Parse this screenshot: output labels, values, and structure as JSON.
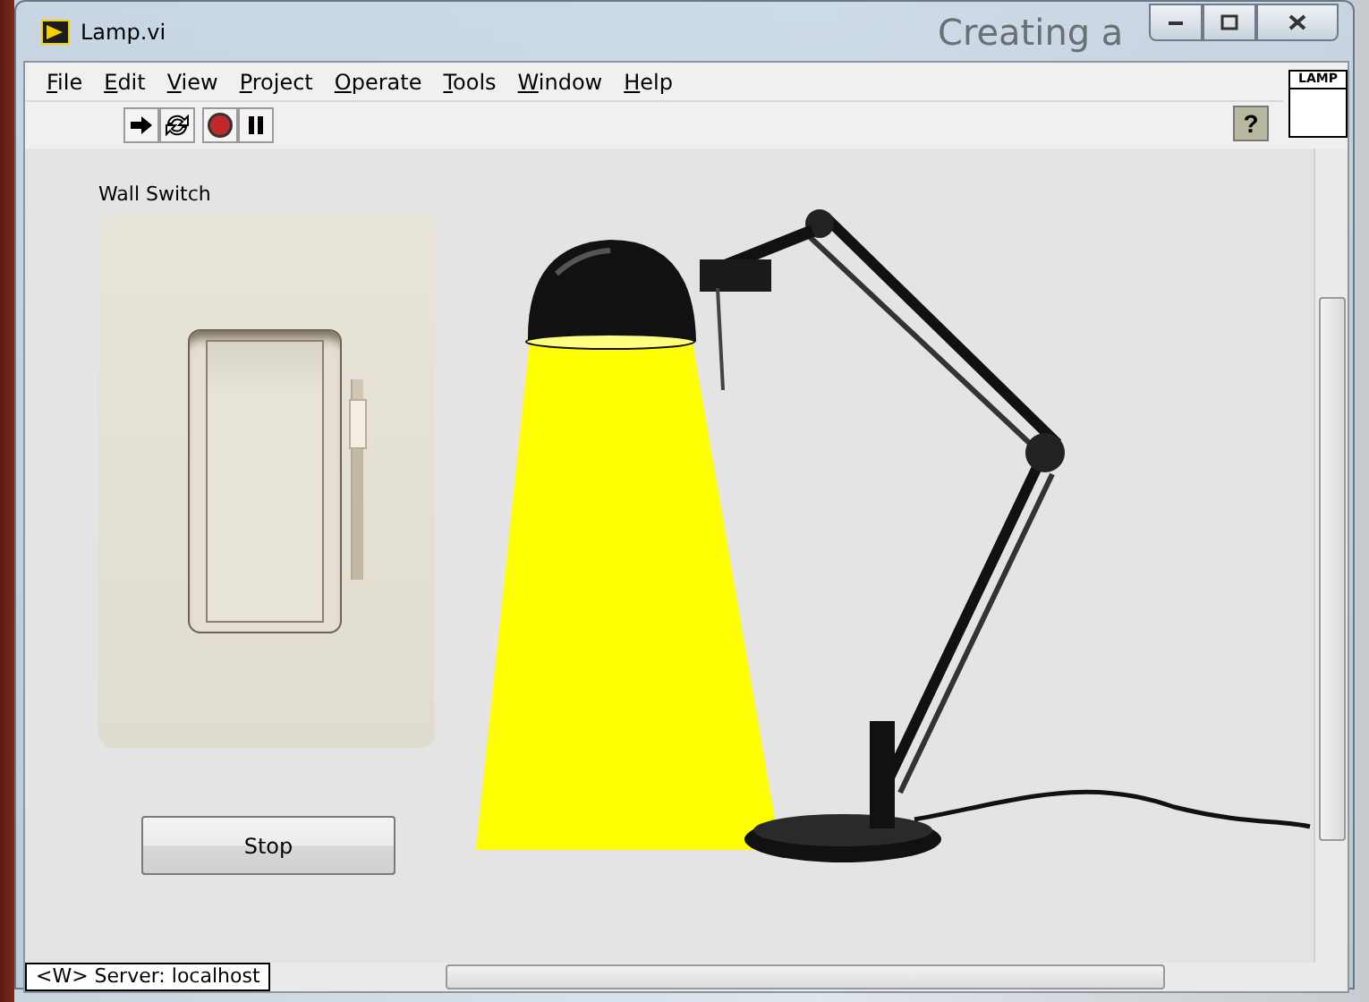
{
  "background_window": {
    "title": "Creating a"
  },
  "window": {
    "title": "Lamp.vi"
  },
  "menu": [
    {
      "label": "File"
    },
    {
      "label": "Edit"
    },
    {
      "label": "View"
    },
    {
      "label": "Project"
    },
    {
      "label": "Operate"
    },
    {
      "label": "Tools"
    },
    {
      "label": "Window"
    },
    {
      "label": "Help"
    }
  ],
  "toolbar": [
    {
      "kind": "run"
    },
    {
      "kind": "run-continuously"
    },
    {
      "kind": "abort"
    },
    {
      "kind": "pause"
    }
  ],
  "help_button": {
    "label": "?"
  },
  "connector_pane": {
    "label": "LAMP"
  },
  "panel": {
    "wall_switch": {
      "label": "Wall Switch",
      "on": true,
      "level": 0.9
    },
    "stop_button": {
      "label": "Stop"
    },
    "lamp": {
      "on": true
    }
  },
  "status_bar": {
    "target": "<W> Server: localhost"
  }
}
